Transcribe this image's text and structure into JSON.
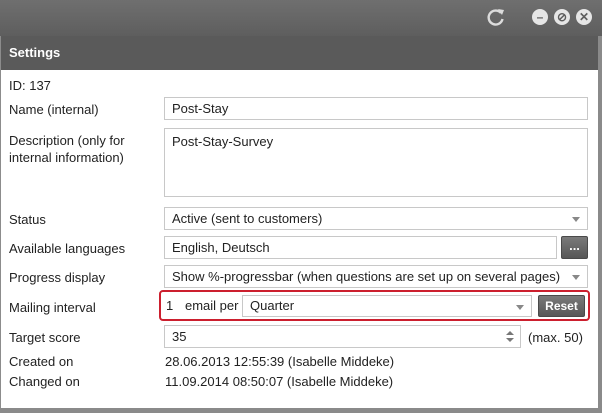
{
  "window": {
    "controls": {
      "minimize": "–",
      "disable": "⊘",
      "close": "✕"
    }
  },
  "settings": {
    "header": "Settings",
    "id_line": "ID: 137",
    "name_label": "Name (internal)",
    "name_value": "Post-Stay",
    "description_label": "Description (only for internal information)",
    "description_value": "Post-Stay-Survey",
    "status_label": "Status",
    "status_value": "Active (sent to customers)",
    "languages_label": "Available languages",
    "languages_value": "English, Deutsch",
    "languages_button": "...",
    "progress_label": "Progress display",
    "progress_value": "Show %-progressbar (when questions are set up on several pages)",
    "mailing_label": "Mailing interval",
    "mailing_count": "1",
    "mailing_per": "email per",
    "mailing_period": "Quarter",
    "mailing_reset": "Reset",
    "target_label": "Target score",
    "target_value": "35",
    "target_max": "(max. 50)",
    "created_label": "Created on",
    "created_value": "28.06.2013 12:55:39 (Isabelle Middeke)",
    "changed_label": "Changed on",
    "changed_value": "11.09.2014 08:50:07 (Isabelle Middeke)"
  },
  "colors": {
    "titlebar": "#656565",
    "header": "#5a5a5a",
    "highlight": "#cc1f2e",
    "button": "#666666"
  }
}
